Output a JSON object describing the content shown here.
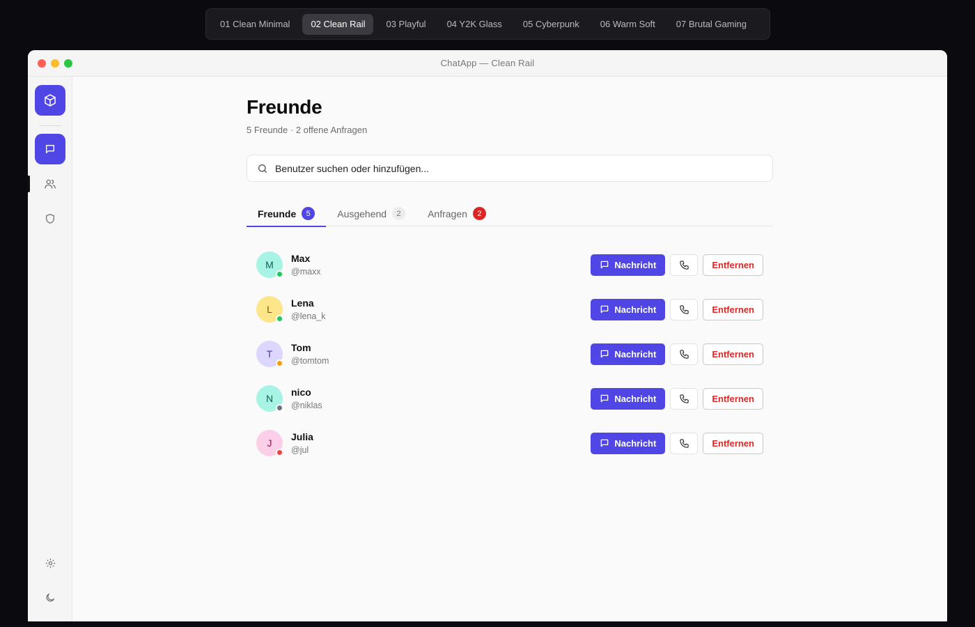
{
  "themes": {
    "items": [
      {
        "label": "01 Clean Minimal"
      },
      {
        "label": "02 Clean Rail",
        "active": true
      },
      {
        "label": "03 Playful"
      },
      {
        "label": "04 Y2K Glass"
      },
      {
        "label": "05 Cyberpunk"
      },
      {
        "label": "06 Warm Soft"
      },
      {
        "label": "07 Brutal Gaming"
      }
    ]
  },
  "window": {
    "title": "ChatApp — Clean Rail"
  },
  "rail": {
    "icons": [
      "cube-icon",
      "chat-icon",
      "users-icon",
      "shield-icon",
      "gear-icon",
      "moon-icon"
    ],
    "active": "users-icon"
  },
  "page": {
    "title": "Freunde",
    "subtitle": "5 Freunde · 2 offene Anfragen"
  },
  "search": {
    "placeholder": "Benutzer suchen oder hinzufügen..."
  },
  "tabs": [
    {
      "label": "Freunde",
      "count": "5",
      "active": true
    },
    {
      "label": "Ausgehend",
      "count": "2"
    },
    {
      "label": "Anfragen",
      "count": "2"
    }
  ],
  "actions": {
    "message_label": "Nachricht",
    "remove_label": "Entfernen"
  },
  "friends": [
    {
      "initial": "M",
      "name": "Max",
      "handle": "@maxx",
      "avatar_bg": "#a7f3e4",
      "avatar_fg": "#0f5f53",
      "status_color": "#22c55e"
    },
    {
      "initial": "L",
      "name": "Lena",
      "handle": "@lena_k",
      "avatar_bg": "#fde68a",
      "avatar_fg": "#7a5a05",
      "status_color": "#22c55e"
    },
    {
      "initial": "T",
      "name": "Tom",
      "handle": "@tomtom",
      "avatar_bg": "#ddd6fe",
      "avatar_fg": "#4c3aa0",
      "status_color": "#f59e0b"
    },
    {
      "initial": "N",
      "name": "nico",
      "handle": "@niklas",
      "avatar_bg": "#a7f3e4",
      "avatar_fg": "#0f5f53",
      "status_color": "#6b7280"
    },
    {
      "initial": "J",
      "name": "Julia",
      "handle": "@jul",
      "avatar_bg": "#fbcfe8",
      "avatar_fg": "#9d174d",
      "status_color": "#ef4444"
    }
  ],
  "colors": {
    "accent": "#4f46e5",
    "danger": "#dc2626"
  }
}
